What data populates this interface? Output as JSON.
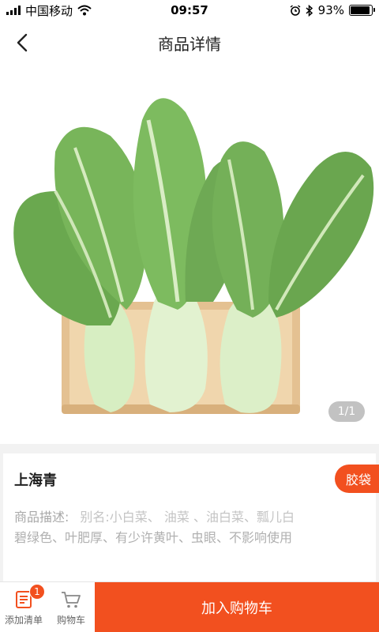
{
  "status_bar": {
    "carrier": "中国移动",
    "time": "09:57",
    "battery_text": "93%",
    "battery_level": 0.93,
    "icons": [
      "signal-icon",
      "wifi-icon",
      "alarm-icon",
      "bluetooth-icon",
      "battery-icon"
    ]
  },
  "nav": {
    "title": "商品详情",
    "back_icon": "chevron-left-icon"
  },
  "gallery": {
    "pager": "1/1",
    "image_subject": "bok-choy"
  },
  "product": {
    "name": "上海青",
    "package_badge": "胶袋",
    "desc_label": "商品描述:",
    "desc_alias": "别名:小白菜、 油菜 、油白菜、瓢儿白",
    "desc_detail": "碧绿色、叶肥厚、有少许黄叶、虫眼、不影响使用"
  },
  "bottom_bar": {
    "list_label": "添加清单",
    "cart_label": "购物车",
    "cart_count": "1",
    "add_to_cart": "加入购物车"
  },
  "colors": {
    "accent": "#f2501f",
    "leaf": "#6fae52",
    "tray": "#e9c998"
  }
}
